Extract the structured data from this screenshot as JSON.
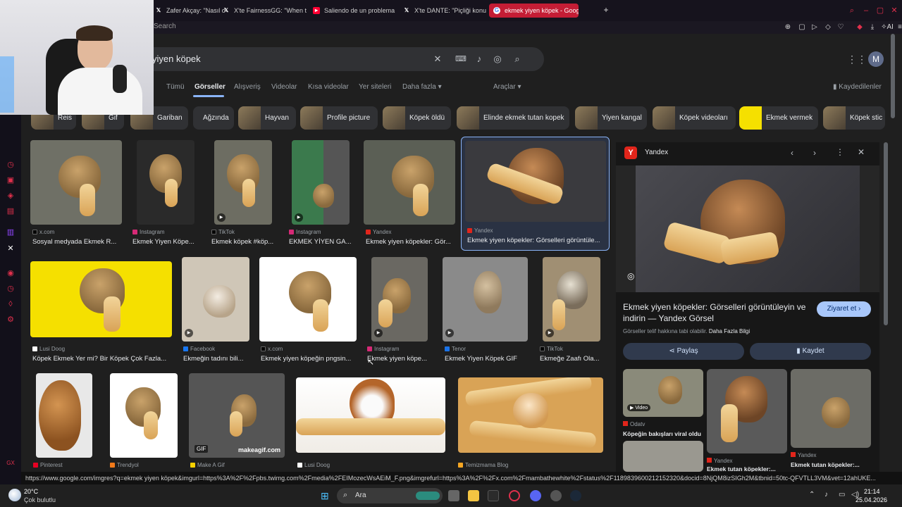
{
  "tabs": [
    {
      "label": "Zafer Akçay: \"Nasıl o",
      "icon": "x-icon"
    },
    {
      "label": "X'te FairnessGG: \"When t",
      "icon": "x-icon"
    },
    {
      "label": "Saliendo de un problema p",
      "icon": "youtube-icon"
    },
    {
      "label": "X'te DANTE: \"Piçliği konu",
      "icon": "x-icon"
    },
    {
      "label": "ekmek yiyen köpek - Goog",
      "icon": "google-icon",
      "active": true
    }
  ],
  "address": {
    "placeholder": "Search"
  },
  "search": {
    "query": "yiyen köpek"
  },
  "avatar_letter": "M",
  "nav": {
    "tabs": [
      "Tümü",
      "Görseller",
      "Alışveriş",
      "Videolar",
      "Kısa videolar",
      "Yer siteleri",
      "Daha fazla"
    ],
    "active": "Görseller",
    "tools": "Araçlar",
    "saved": "Kaydedilenler"
  },
  "chips": [
    "Reis",
    "Gif",
    "Gariban",
    "Ağzında",
    "Hayvan",
    "Profile picture",
    "Köpek öldü",
    "Elinde ekmek tutan kopek",
    "Yiyen kangal",
    "Köpek videoları",
    "Ekmek vermek",
    "Köpek stic"
  ],
  "results": [
    {
      "source": "x.com",
      "caption": "Sosyal medyada Ekmek R..."
    },
    {
      "source": "Instagram",
      "caption": "Ekmek Yiyen Köpe..."
    },
    {
      "source": "TikTok",
      "caption": "Ekmek köpek #köp..."
    },
    {
      "source": "Instagram",
      "caption": "EKMEK YİYEN GA..."
    },
    {
      "source": "Yandex",
      "caption": "Ekmek yiyen köpekler: Gör..."
    },
    {
      "source": "Yandex",
      "caption": "Ekmek yiyen köpekler: Görselleri görüntüle..."
    },
    {
      "source": "Lusi Doog",
      "caption": "Köpek Ekmek Yer mi? Bir Köpek Çok Fazla..."
    },
    {
      "source": "Facebook",
      "caption": "Ekmeğin tadını bili..."
    },
    {
      "source": "x.com",
      "caption": "Ekmek yiyen köpeğin pngsin..."
    },
    {
      "source": "Instagram",
      "caption": "Ekmek yiyen köpe..."
    },
    {
      "source": "Tenor",
      "caption": "Ekmek Yiyen Köpek GIF"
    },
    {
      "source": "TikTok",
      "caption": "Ekmeğe Zaafı Ola..."
    },
    {
      "source": "Pinterest",
      "caption": ""
    },
    {
      "source": "Trendyol",
      "caption": ""
    },
    {
      "source": "Make A Gif",
      "caption": ""
    },
    {
      "source": "Lusi Doog",
      "caption": ""
    },
    {
      "source": "Temizmama Blog",
      "caption": ""
    }
  ],
  "badges": {
    "gif": "GIF",
    "makeagif": "makeagif.com",
    "video": "Video"
  },
  "panel": {
    "source": "Yandex",
    "title": "Ekmek yiyen köpekler: Görselleri görüntüleyin ve indirin — Yandex Görsel",
    "visit": "Ziyaret et",
    "copyright": "Görseller telif hakkına tabi olabilir.",
    "more_info": "Daha Fazla Bilgi",
    "share": "Paylaş",
    "save": "Kaydet",
    "related": [
      {
        "source": "Odatv",
        "caption": "Köpeğin bakışları viral oldu"
      },
      {
        "source": "Yandex",
        "caption": "Ekmek tutan köpekler:..."
      },
      {
        "source": "Yandex",
        "caption": "Ekmek tutan köpekler:..."
      }
    ]
  },
  "status_url": "https://www.google.com/imgres?q=ekmek yiyen köpek&imgurl=https%3A%2F%2Fpbs.twimg.com%2Fmedia%2FEIMozecWsAEiM_F.png&imgrefurl=https%3A%2F%2Fx.com%2Fmambathewhite%2Fstatus%2F1189839600212152320&docid=8NjQM8izSIGh2M&tbnid=50tc-QFVTLL3VM&vet=12ahUKE...",
  "taskbar": {
    "weather_temp": "20°C",
    "weather_desc": "Çok bulutlu",
    "search": "Ara",
    "time": "21:14",
    "date": "25.04.2026"
  },
  "colors": {
    "accent": "#c41d35",
    "google_blue": "#8ab4f8",
    "page_bg": "#1f1f1f"
  }
}
